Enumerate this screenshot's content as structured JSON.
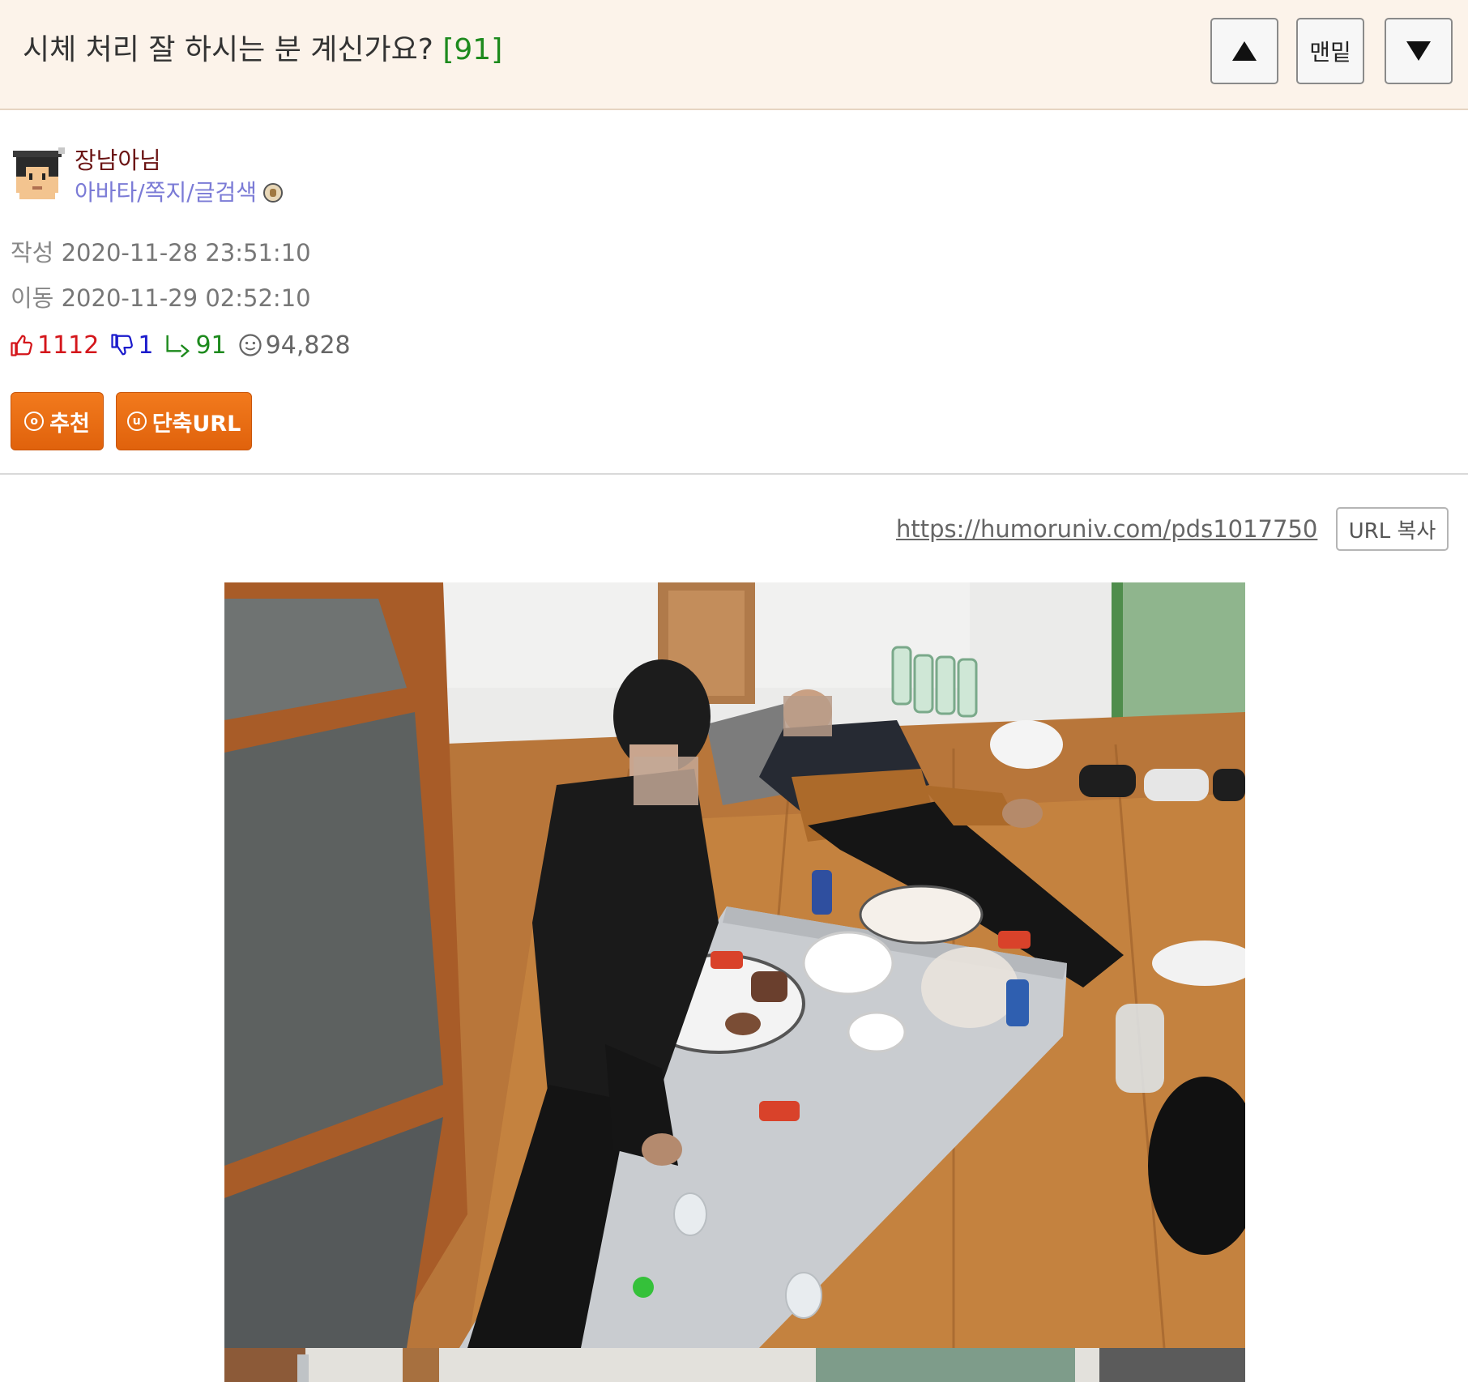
{
  "header": {
    "title": "시체 처리 잘 하시는 분 계신가요?",
    "comment_count": "[91]",
    "bottom_label": "맨밑"
  },
  "author": {
    "name": "장남아님",
    "link_avatar": "아바타",
    "link_message": "쪽지",
    "link_search": "글검색",
    "separator": "/"
  },
  "meta": {
    "created_label": "작성",
    "created_value": "2020-11-28 23:51:10",
    "moved_label": "이동",
    "moved_value": "2020-11-29 02:52:10"
  },
  "stats": {
    "upvotes": "1112",
    "downvotes": "1",
    "replies": "91",
    "views": "94,828"
  },
  "buttons": {
    "recommend_icon": "ⓞ",
    "recommend_label": "추천",
    "short_url_icon": "ⓤ",
    "short_url_label": "단축URL"
  },
  "url": {
    "link": "https://humoruniv.com/pds1017750",
    "copy_label": "URL 복사"
  },
  "icons": {
    "up": "triangle-up-icon",
    "down": "triangle-down-icon",
    "thumbs_up": "thumbs-up-icon",
    "thumbs_down": "thumbs-down-icon",
    "reply": "reply-arrow-icon",
    "views": "smiley-icon",
    "badge": "level-badge-icon"
  },
  "colors": {
    "header_bg": "#fcf3ea",
    "count_green": "#1d8a1d",
    "author_name": "#6b1414",
    "author_links": "#7b7bd6",
    "upvote_red": "#d4161b",
    "downvote_blue": "#1b1bcc",
    "button_orange": "#e8690f"
  }
}
